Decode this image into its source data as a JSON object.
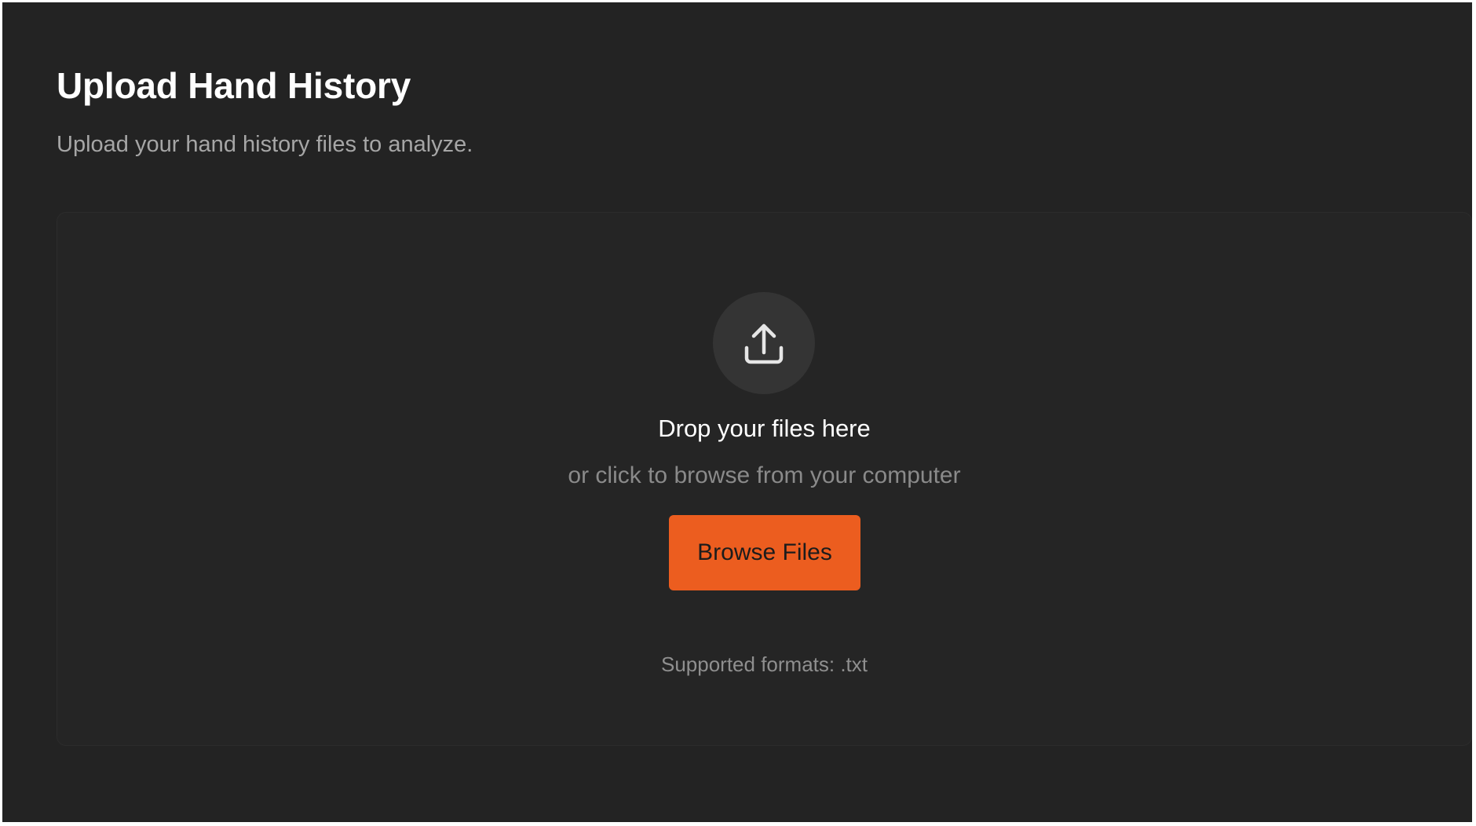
{
  "page": {
    "title": "Upload Hand History",
    "subtitle": "Upload your hand history files to analyze."
  },
  "dropzone": {
    "icon": "upload-icon",
    "title": "Drop your files here",
    "subtitle": "or click to browse from your computer",
    "button_label": "Browse Files",
    "formats_note": "Supported formats: .txt"
  },
  "colors": {
    "background": "#232323",
    "dropzone_background": "#252525",
    "icon_circle": "#343434",
    "accent": "#ec5d1f",
    "muted_text": "#8a8a8a"
  }
}
